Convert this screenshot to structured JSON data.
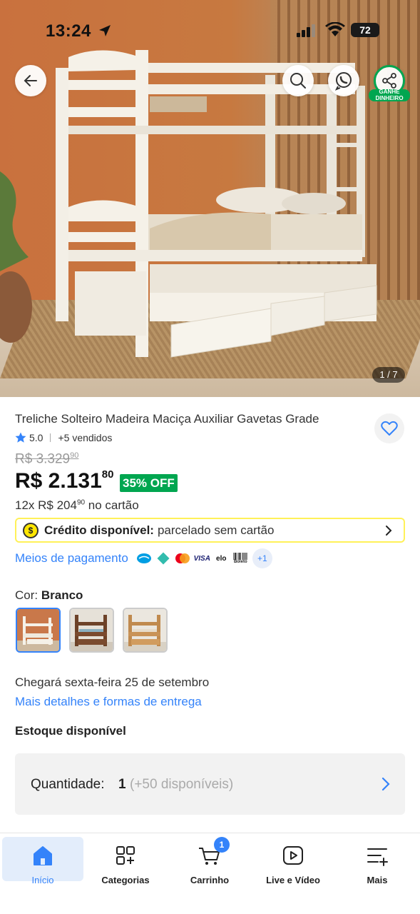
{
  "status_bar": {
    "time": "13:24",
    "battery": "72"
  },
  "gallery": {
    "counter": "1 / 7",
    "share_badge_line1": "GANHE",
    "share_badge_line2": "DINHEIRO"
  },
  "product": {
    "title": "Treliche Solteiro Madeira Maciça Auxiliar Gavetas Grade",
    "rating": "5.0",
    "sold": "+5 vendidos",
    "old_price": "R$ 3.329",
    "old_price_cents": "90",
    "price": "R$ 2.131",
    "price_cents": "80",
    "discount": "35% OFF",
    "installments_prefix": "12x R$ 204",
    "installments_cents": "90",
    "installments_suffix": " no cartão"
  },
  "credit": {
    "icon": "$",
    "label_bold": "Crédito disponível:",
    "label_rest": "parcelado sem cartão"
  },
  "payment": {
    "link": "Meios de pagamento",
    "methods": [
      "Mercado Pago",
      "Pix",
      "Mastercard",
      "VISA",
      "elo",
      "Boleto"
    ],
    "visa_text": "VISA",
    "elo_text": "elo",
    "boleto_text": "Boleto",
    "more": "+1"
  },
  "color": {
    "label": "Cor:",
    "selected": "Branco",
    "options": [
      "Branco",
      "Marrom escuro",
      "Natural"
    ]
  },
  "delivery": {
    "text": "Chegará sexta-feira 25 de setembro",
    "link": "Mais detalhes e formas de entrega"
  },
  "stock": {
    "label": "Estoque disponível"
  },
  "quantity": {
    "label": "Quantidade:",
    "value": "1",
    "available": "(+50 disponíveis)"
  },
  "bottom_nav": {
    "items": [
      {
        "label": "Início",
        "icon": "home-icon",
        "active": true
      },
      {
        "label": "Categorias",
        "icon": "categories-icon"
      },
      {
        "label": "Carrinho",
        "icon": "cart-icon",
        "badge": "1"
      },
      {
        "label": "Live e Vídeo",
        "icon": "play-icon"
      },
      {
        "label": "Mais",
        "icon": "menu-plus-icon"
      }
    ]
  },
  "colors": {
    "accent_blue": "#3483fa",
    "green": "#00a650",
    "yellow": "#fff159"
  }
}
